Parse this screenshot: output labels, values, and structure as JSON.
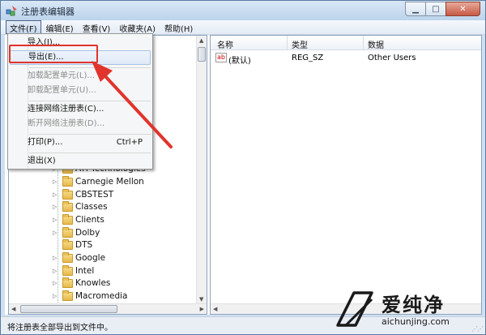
{
  "window": {
    "title": "注册表编辑器",
    "controls": {
      "minimize": "▁",
      "maximize": "□",
      "close": "✕"
    }
  },
  "menubar": {
    "items": [
      "文件(F)",
      "编辑(E)",
      "查看(V)",
      "收藏夹(A)",
      "帮助(H)"
    ],
    "active_index": 0
  },
  "file_menu": {
    "items": [
      {
        "label": "导入(I)...",
        "enabled": true,
        "shortcut": ""
      },
      {
        "label": "导出(E)...",
        "enabled": true,
        "shortcut": "",
        "hovered": true
      },
      {
        "label": "加载配置单元(L)...",
        "enabled": false,
        "shortcut": ""
      },
      {
        "label": "卸载配置单元(U)...",
        "enabled": false,
        "shortcut": ""
      },
      {
        "label": "连接网络注册表(C)...",
        "enabled": true,
        "shortcut": ""
      },
      {
        "label": "断开网络注册表(D)...",
        "enabled": false,
        "shortcut": ""
      },
      {
        "label": "打印(P)...",
        "enabled": true,
        "shortcut": "Ctrl+P"
      },
      {
        "label": "退出(X)",
        "enabled": true,
        "shortcut": ""
      }
    ]
  },
  "tree": {
    "items": [
      "ATI Technologies",
      "Carnegie Mellon",
      "CBSTEST",
      "Classes",
      "Clients",
      "Dolby",
      "DTS",
      "Google",
      "Intel",
      "Knowles",
      "Macromedia"
    ]
  },
  "list": {
    "columns": [
      "名称",
      "类型",
      "数据"
    ],
    "rows": [
      {
        "icon": "string-value-icon",
        "icon_text": "ab",
        "name": "(默认)",
        "type": "REG_SZ",
        "data": "Other Users"
      }
    ]
  },
  "statusbar": {
    "text": "将注册表全部导出到文件中。"
  },
  "annotation": {
    "box_color": "#e0342c",
    "arrow_color": "#e0342c"
  },
  "watermark": {
    "brand": "爱纯净",
    "url": "aichunjing.com"
  }
}
